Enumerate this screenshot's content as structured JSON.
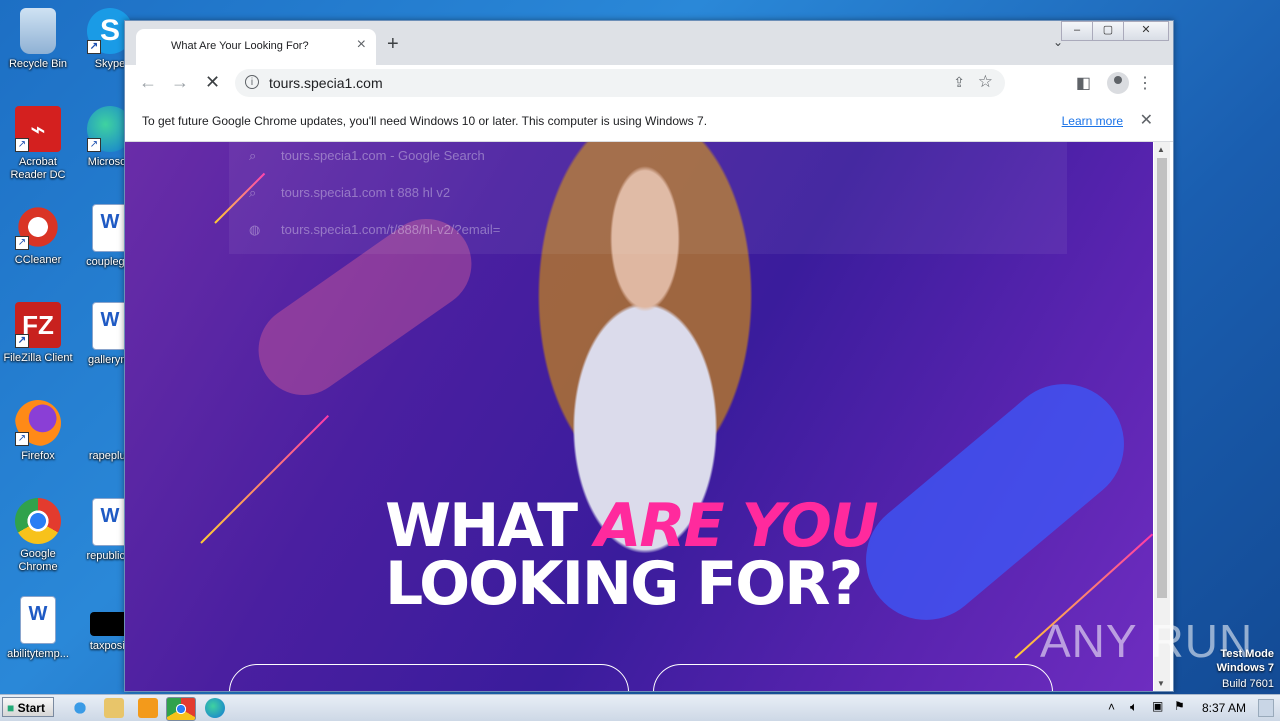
{
  "desktop": {
    "icons": [
      {
        "label": "Recycle Bin"
      },
      {
        "label": "Skype"
      },
      {
        "label": "Acrobat Reader DC"
      },
      {
        "label": "Microsoft"
      },
      {
        "label": "CCleaner"
      },
      {
        "label": "couplegm"
      },
      {
        "label": "FileZilla Client"
      },
      {
        "label": "gallerymi"
      },
      {
        "label": "Firefox"
      },
      {
        "label": "rapeplus"
      },
      {
        "label": "Google Chrome"
      },
      {
        "label": "republicin"
      },
      {
        "label": "abilitytemp..."
      },
      {
        "label": "taxpositi"
      }
    ]
  },
  "browser": {
    "tab": {
      "title": "What Are Your Looking For?"
    },
    "toolbar": {
      "url": "tours.specia1.com"
    },
    "infobar": {
      "message": "To get future Google Chrome updates, you'll need Windows 10 or later. This computer is using Windows 7.",
      "learn_more": "Learn more"
    },
    "suggestions": [
      {
        "text": "tours.specia1.com - Google Search"
      },
      {
        "text": "tours.specia1.com t 888 hl v2"
      },
      {
        "text": "tours.specia1.com/t/888/hl-v2/?email="
      }
    ]
  },
  "page": {
    "headline_line1_a": "WHAT",
    "headline_line1_b": "ARE YOU",
    "headline_line2": "LOOKING FOR?",
    "accent_color": "#ff2a9d"
  },
  "watermark": "ANY RUN",
  "taskbar": {
    "start_label": "Start",
    "clock": "8:37 AM"
  },
  "system": {
    "test_mode": "Test Mode",
    "os": "Windows 7",
    "build": "Build 7601"
  }
}
